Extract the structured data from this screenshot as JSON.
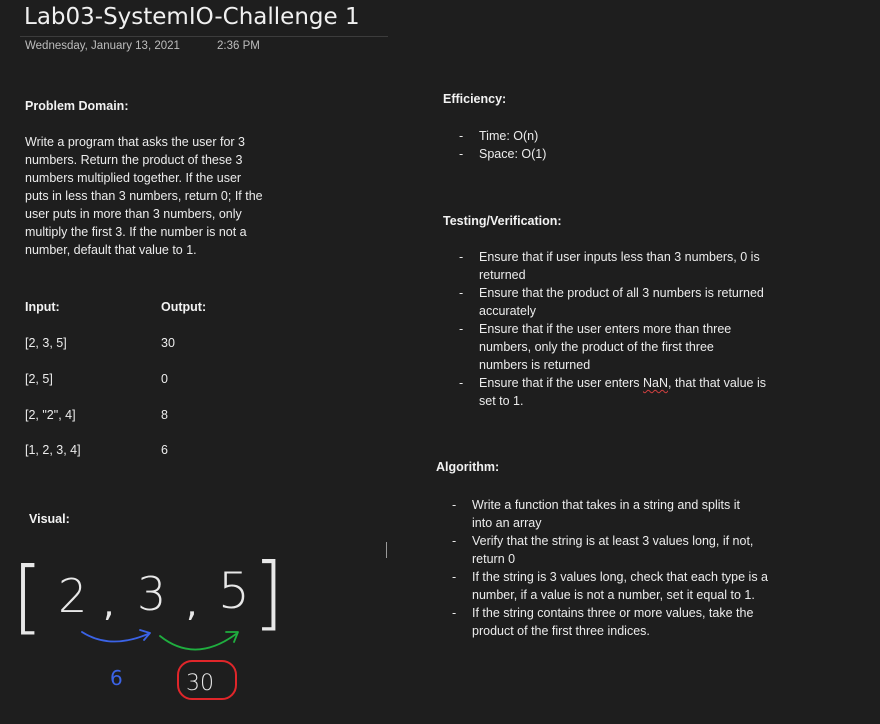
{
  "page": {
    "title": "Lab03-SystemIO-Challenge 1",
    "date": "Wednesday, January 13, 2021",
    "time": "2:36 PM"
  },
  "problem": {
    "heading": "Problem Domain:",
    "lines": [
      "Write a program that asks the user for 3",
      "numbers. Return the product of these 3",
      "numbers multiplied together. If the user",
      "puts in less than 3 numbers, return 0; If the",
      "user puts in more than 3 numbers, only",
      "multiply the first 3. If the number is not a",
      "number, default that value to 1."
    ]
  },
  "io_table": {
    "input_header": "Input:",
    "output_header": "Output:",
    "rows": [
      {
        "input": "[2, 3, 5]",
        "output": "30"
      },
      {
        "input": "[2, 5]",
        "output": "0"
      },
      {
        "input": "[2, \"2\", 4]",
        "output": "8"
      },
      {
        "input": "[1, 2, 3, 4]",
        "output": "6"
      }
    ]
  },
  "visual": {
    "heading": "Visual:",
    "open_bracket": "[",
    "d1": "2",
    "comma1": ",",
    "d2": "3",
    "comma2": ",",
    "d3": "5",
    "close_bracket": "]",
    "partial_result": "6",
    "final_result": "30",
    "colors": {
      "blue": "#3b63e6",
      "green": "#1fae3f",
      "red": "#e0262a",
      "ink": "#e8e8e8"
    }
  },
  "efficiency": {
    "heading": "Efficiency:",
    "items": [
      [
        "Time: O(n)"
      ],
      [
        "Space: O(1)"
      ]
    ]
  },
  "testing": {
    "heading": "Testing/Verification:",
    "items": [
      [
        "Ensure that if user inputs less than 3 numbers, 0 is",
        "returned"
      ],
      [
        "Ensure that the product of all 3 numbers is returned",
        "accurately"
      ],
      [
        "Ensure that if the user enters more than three",
        "numbers, only the product of the first three",
        "numbers is returned"
      ],
      [
        "Ensure that if the user enters NaN, that that value is",
        "set to 1."
      ]
    ]
  },
  "algorithm": {
    "heading": "Algorithm:",
    "items": [
      [
        "Write a function that takes in a string and splits it",
        "into an array"
      ],
      [
        "Verify that the string is at least 3 values long, if not,",
        "return 0"
      ],
      [
        "If the string is 3 values long, check that each type is a",
        "number, if a value is not a number, set it equal to 1."
      ],
      [
        "If the string contains three or more values, take the",
        "product of the first three indices."
      ]
    ]
  }
}
